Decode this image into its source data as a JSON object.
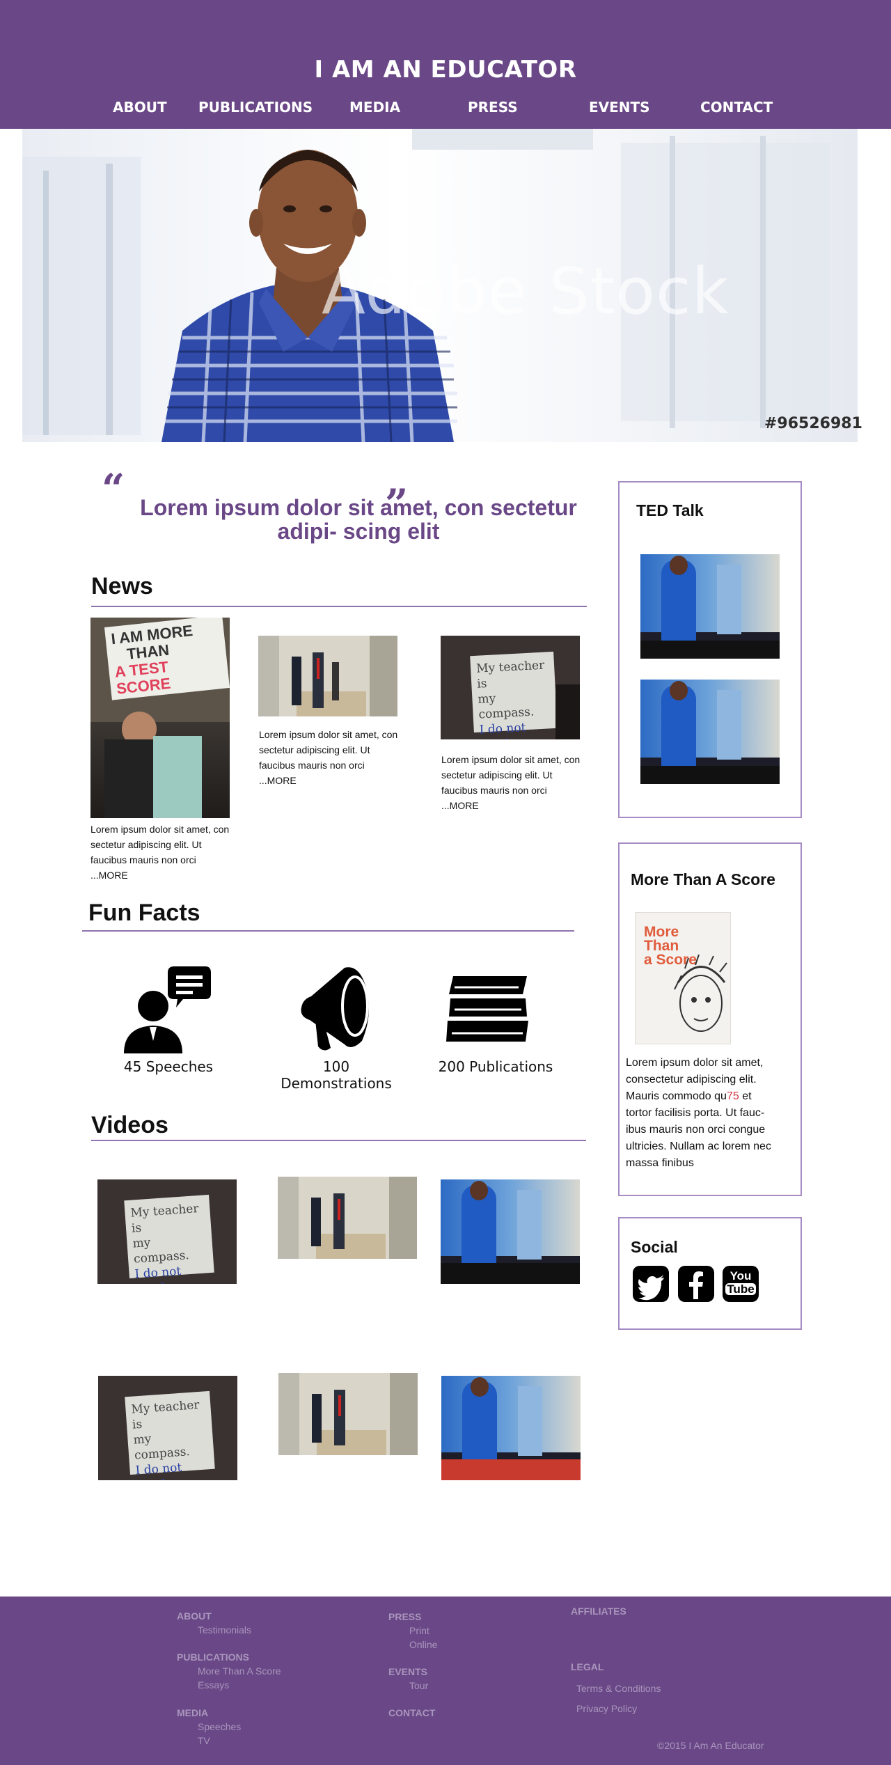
{
  "site": {
    "title": "I AM AN EDUCATOR",
    "nav": [
      "ABOUT",
      "PUBLICATIONS",
      "MEDIA",
      "PRESS",
      "EVENTS",
      "CONTACT"
    ]
  },
  "hero": {
    "watermark": "Adobe Stock",
    "photo_id": "#96526981"
  },
  "quote": {
    "open_mark": "“",
    "close_mark": "”",
    "text": "Lorem ipsum dolor sit amet, con sectetur adipi- scing elit"
  },
  "news": {
    "title": "News",
    "items": [
      {
        "text": "Lorem ipsum dolor sit amet, con sectetur adipiscing elit. Ut faucibus mauris non orci",
        "more": "...MORE",
        "sign": [
          "I AM MORE",
          "THAN",
          "A TEST SCORE"
        ]
      },
      {
        "text": "Lorem ipsum dolor sit amet, con sectetur adipiscing elit. Ut faucibus mauris non orci",
        "more": "...MORE"
      },
      {
        "text": "Lorem ipsum dolor sit amet, con sectetur adipiscing elit. Ut faucibus mauris non orci",
        "more": "...MORE",
        "sign": [
          "My teacher is",
          "my compass.",
          "I do not need"
        ]
      }
    ]
  },
  "fun_facts": {
    "title": "Fun Facts",
    "items": [
      {
        "icon": "speech-person-icon",
        "label": "45 Speeches"
      },
      {
        "icon": "megaphone-icon",
        "label": "100 Demonstrations"
      },
      {
        "icon": "books-icon",
        "label": "200 Publications"
      }
    ]
  },
  "videos": {
    "title": "Videos",
    "sign": [
      "My teacher is",
      "my compass.",
      "I do not need"
    ]
  },
  "sidebar": {
    "ted": {
      "title": "TED Talk"
    },
    "book": {
      "title": "More Than A Score",
      "cover_title": [
        "More",
        "Than",
        "a Score"
      ],
      "text_before": "Lorem ipsum dolor sit amet, consectetur adipiscing elit. Mauris commodo qu",
      "text_red": "75",
      "text_after": " et tortor facilisis porta. Ut fauc- ibus mauris non orci congue ultricies. Nullam ac lorem nec massa finibus"
    },
    "social": {
      "title": "Social",
      "icons": [
        "twitter-icon",
        "facebook-icon",
        "youtube-icon"
      ],
      "youtube_label": [
        "You",
        "Tube"
      ]
    }
  },
  "footer": {
    "about": {
      "head": "ABOUT",
      "links": [
        "Testimonials"
      ]
    },
    "publications": {
      "head": "PUBLICATIONS",
      "links": [
        "More Than A Score",
        "Essays"
      ]
    },
    "media": {
      "head": "MEDIA",
      "links": [
        "Speeches",
        "TV"
      ]
    },
    "press": {
      "head": "PRESS",
      "links": [
        "Print",
        "Online"
      ]
    },
    "events": {
      "head": "EVENTS",
      "links": [
        "Tour"
      ]
    },
    "contact": {
      "head": "CONTACT"
    },
    "affiliates": {
      "head": "AFFILIATES"
    },
    "legal": {
      "head": "LEGAL",
      "links": [
        "Terms & Conditions",
        "Privacy Policy"
      ]
    },
    "copyright": "©2015 I Am An Educator"
  },
  "colors": {
    "brand": "#6a4786",
    "rule": "#8f72ad",
    "footer_text": "#a996bd"
  }
}
